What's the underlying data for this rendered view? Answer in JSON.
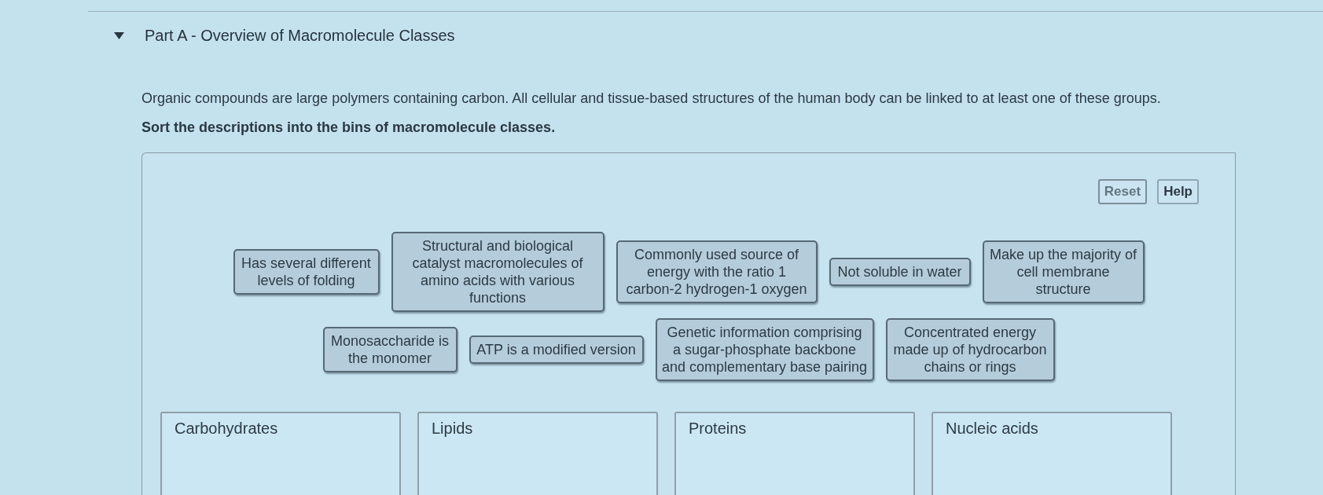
{
  "part": {
    "title": "Part A - Overview of Macromolecule Classes",
    "expanded": true
  },
  "instructions": {
    "intro": "Organic compounds are large polymers containing carbon. All cellular and tissue-based structures of the human body can be linked to at least one of these groups.",
    "task": "Sort the descriptions into the bins of macromolecule classes."
  },
  "activity": {
    "buttons": [
      {
        "label": "Reset",
        "disabled": true
      },
      {
        "label": "Help",
        "disabled": false
      }
    ],
    "card_rows": [
      [
        {
          "text": "Has several different levels of folding"
        },
        {
          "text": "Structural and biological catalyst macromolecules of amino acids with various functions"
        },
        {
          "text": "Commonly used source of energy with the ratio 1 carbon-2 hydrogen-1 oxygen"
        },
        {
          "text": "Not soluble in water"
        },
        {
          "text": "Make up the majority of cell membrane structure"
        }
      ],
      [
        {
          "text": "Monosaccharide is the monomer"
        },
        {
          "text": "ATP is a modified version"
        },
        {
          "text": "Genetic information comprising a sugar-phosphate backbone and complementary base pairing"
        },
        {
          "text": "Concentrated energy made up of hydrocarbon chains or rings"
        }
      ]
    ],
    "bins": [
      {
        "label": "Carbohydrates"
      },
      {
        "label": "Lipids"
      },
      {
        "label": "Proteins"
      },
      {
        "label": "Nucleic acids"
      }
    ]
  }
}
